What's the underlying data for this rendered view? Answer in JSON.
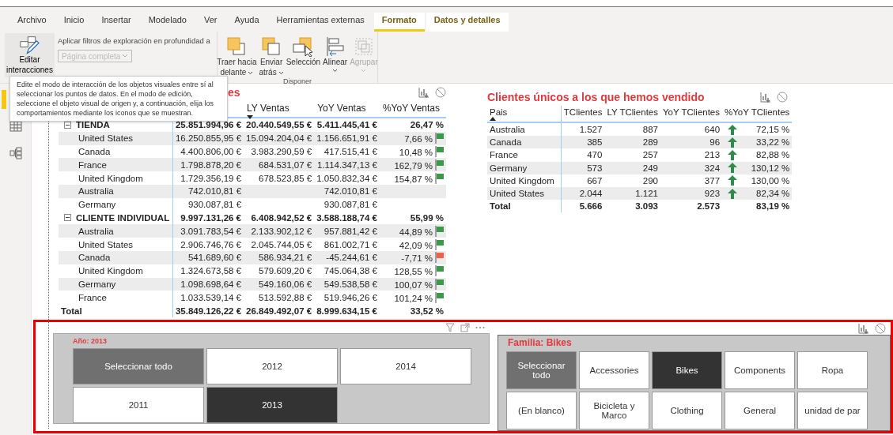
{
  "ribbon": {
    "tabs": [
      {
        "label": "Archivo",
        "selected": false,
        "contextual": false
      },
      {
        "label": "Inicio",
        "selected": false,
        "contextual": false
      },
      {
        "label": "Insertar",
        "selected": false,
        "contextual": false
      },
      {
        "label": "Modelado",
        "selected": false,
        "contextual": false
      },
      {
        "label": "Ver",
        "selected": false,
        "contextual": false
      },
      {
        "label": "Ayuda",
        "selected": false,
        "contextual": false
      },
      {
        "label": "Herramientas externas",
        "selected": false,
        "contextual": false
      },
      {
        "label": "Formato",
        "selected": true,
        "contextual": true
      },
      {
        "label": "Datos y detalles",
        "selected": false,
        "contextual": true
      }
    ],
    "interactions": {
      "button": {
        "lines": [
          "Editar",
          "interacciones"
        ]
      },
      "drill_label": "Aplicar filtros de exploración en profundidad a",
      "drill_dropdown": {
        "value": "Página completa",
        "disabled": true
      }
    },
    "arrange": {
      "group_label": "Disponer",
      "buttons": [
        {
          "kind": "bring-forward",
          "lines": [
            "Traer hacia",
            "delante"
          ],
          "menu": true,
          "disabled": false
        },
        {
          "kind": "send-backward",
          "lines": [
            "Enviar",
            "atrás"
          ],
          "menu": true,
          "disabled": false
        },
        {
          "kind": "selection",
          "lines": [
            "Selección"
          ],
          "menu": false,
          "disabled": false
        },
        {
          "kind": "align",
          "lines": [
            "Alinear"
          ],
          "menu": true,
          "disabled": false
        },
        {
          "kind": "group",
          "lines": [
            "Agrupar"
          ],
          "menu": true,
          "disabled": true
        }
      ]
    }
  },
  "tooltip": "Edite el modo de interacción de los objetos visuales entre sí al seleccionar los puntos de datos. En el modo de edición, seleccione el objeto visual de origen y, a continuación, elija los comportamientos mediante los iconos que se muestran.",
  "sales_matrix": {
    "title_visible": "es",
    "columns": [
      {
        "label": "LY Ventas",
        "sorted": true
      },
      {
        "label": "YoY Ventas",
        "sorted": false
      },
      {
        "label": "%YoY Ventas",
        "sorted": false
      }
    ],
    "groups": [
      {
        "label": "TIENDA",
        "expanded": true,
        "values": [
          "25.851.994,96 €",
          "20.440.549,55 €",
          "5.411.445,41 €",
          "26,47 %"
        ],
        "rows": [
          {
            "label": "United States",
            "values": [
              "16.250.855,95 €",
              "15.094.204,04 €",
              "1.156.651,91 €",
              "7,66 %"
            ],
            "color": "#3a9a48"
          },
          {
            "label": "Canada",
            "values": [
              "4.400.806,00 €",
              "3.983.290,59 €",
              "417.515,41 €",
              "10,48 %"
            ],
            "color": "#3a9a48"
          },
          {
            "label": "France",
            "values": [
              "1.798.878,20 €",
              "684.531,07 €",
              "1.114.347,13 €",
              "162,79 %"
            ],
            "color": "#3a9a48"
          },
          {
            "label": "United Kingdom",
            "values": [
              "1.729.356,19 €",
              "678.523,85 €",
              "1.050.832,34 €",
              "154,87 %"
            ],
            "color": "#3a9a48"
          },
          {
            "label": "Australia",
            "ventas": "742.010,81 €",
            "yoy_ventas": "742.010,81 €"
          },
          {
            "label": "Germany",
            "ventas": "930.087,81 €",
            "yoy_ventas": "930.087,81 €"
          }
        ]
      },
      {
        "label": "CLIENTE INDIVIDUAL",
        "expanded": true,
        "values": [
          "9.997.131,26 €",
          "6.408.942,52 €",
          "3.588.188,74 €",
          "55,99 %"
        ],
        "rows": [
          {
            "label": "Australia",
            "values": [
              "3.091.783,54 €",
              "2.133.902,12 €",
              "957.881,42 €",
              "44,89 %"
            ],
            "color": "#3a9a48"
          },
          {
            "label": "United States",
            "values": [
              "2.906.746,76 €",
              "2.045.744,05 €",
              "861.002,71 €",
              "42,09 %"
            ],
            "color": "#3a9a48"
          },
          {
            "label": "Canada",
            "values": [
              "541.689,60 €",
              "586.934,21 €",
              "-45.244,61 €",
              "-7,71 %"
            ],
            "color": "#f0604a"
          },
          {
            "label": "United Kingdom",
            "values": [
              "1.324.673,58 €",
              "579.609,20 €",
              "745.064,38 €",
              "128,55 %"
            ],
            "color": "#3a9a48"
          },
          {
            "label": "Germany",
            "values": [
              "1.098.698,64 €",
              "549.160,06 €",
              "549.538,58 €",
              "100,07 %"
            ],
            "color": "#3a9a48"
          },
          {
            "label": "France",
            "values": [
              "1.033.539,14 €",
              "513.592,88 €",
              "519.946,26 €",
              "101,24 %"
            ],
            "color": "#3a9a48"
          }
        ]
      }
    ],
    "total": {
      "label": "Total",
      "values": [
        "35.849.126,22 €",
        "26.849.492,07 €",
        "8.999.634,15 €",
        "33,52 %"
      ]
    }
  },
  "customers_table": {
    "title": "Clientes únicos a los que hemos vendido",
    "columns": [
      {
        "label": "Pais",
        "sorted": true
      },
      {
        "label": "TClientes",
        "sorted": false
      },
      {
        "label": "LY TClientes",
        "sorted": false
      },
      {
        "label": "YoY TClientes",
        "sorted": false
      },
      {
        "label": "%YoY TClientes",
        "sorted": false
      }
    ],
    "rows": [
      {
        "cells": [
          "Australia",
          "1.527",
          "887",
          "640",
          "72,15 %"
        ]
      },
      {
        "cells": [
          "Canada",
          "385",
          "289",
          "96",
          "33,22 %"
        ]
      },
      {
        "cells": [
          "France",
          "470",
          "257",
          "213",
          "82,88 %"
        ]
      },
      {
        "cells": [
          "Germany",
          "573",
          "249",
          "324",
          "130,12 %"
        ]
      },
      {
        "cells": [
          "United Kingdom",
          "667",
          "290",
          "377",
          "130,00 %"
        ]
      },
      {
        "cells": [
          "United States",
          "2.044",
          "1.121",
          "923",
          "82,34 %"
        ]
      }
    ],
    "total": [
      "Total",
      "5.666",
      "3.093",
      "2.573",
      "83,19 %"
    ]
  },
  "year_slicer": {
    "title": "Año: 2013",
    "items": [
      {
        "label": "Seleccionar todo",
        "kind": "select-all",
        "selected": false
      },
      {
        "label": "2012",
        "kind": "value",
        "selected": false
      },
      {
        "label": "2014",
        "kind": "value",
        "selected": false
      },
      {
        "label": "2011",
        "kind": "value",
        "selected": false
      },
      {
        "label": "2013",
        "kind": "value",
        "selected": true
      }
    ]
  },
  "family_slicer": {
    "title": "Familia: Bikes",
    "items": [
      {
        "label": "Seleccionar todo",
        "kind": "select-all",
        "selected": false
      },
      {
        "label": "Accessories",
        "kind": "value",
        "selected": false
      },
      {
        "label": "Bikes",
        "kind": "value",
        "selected": true
      },
      {
        "label": "Components",
        "kind": "value",
        "selected": false
      },
      {
        "label": "Ropa",
        "kind": "value",
        "selected": false
      },
      {
        "label": "(En blanco)",
        "kind": "value",
        "selected": false
      },
      {
        "label": "Bicicleta y Marco",
        "kind": "value",
        "selected": false
      },
      {
        "label": "Clothing",
        "kind": "value",
        "selected": false
      },
      {
        "label": "General",
        "kind": "value",
        "selected": false
      },
      {
        "label": "unidad de par",
        "kind": "value",
        "selected": false
      }
    ]
  }
}
